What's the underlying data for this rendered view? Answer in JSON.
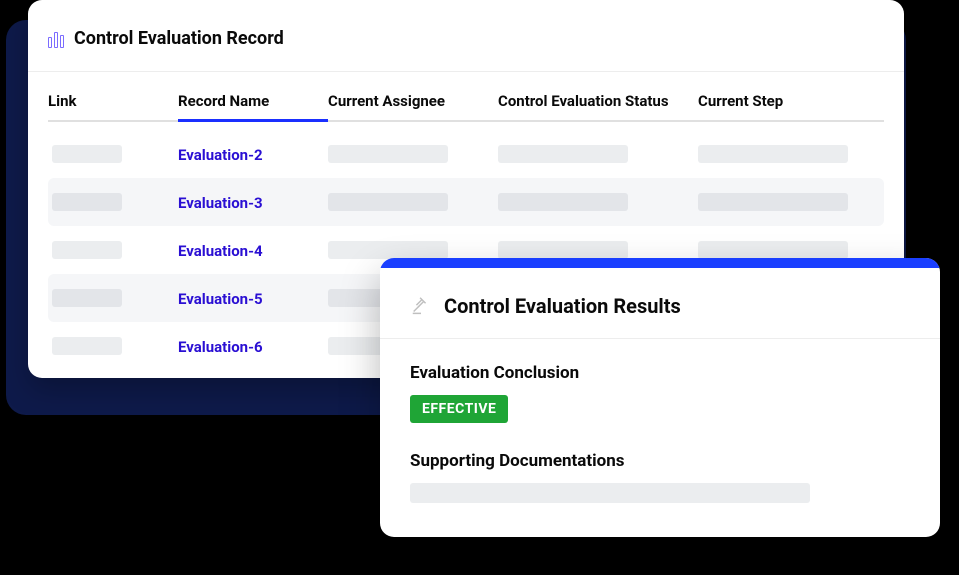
{
  "panel": {
    "title": "Control Evaluation Record"
  },
  "columns": {
    "link": "Link",
    "record_name": "Record Name",
    "assignee": "Current Assignee",
    "status": "Control Evaluation Status",
    "step": "Current Step"
  },
  "rows": [
    {
      "name": "Evaluation-2",
      "alt": false
    },
    {
      "name": "Evaluation-3",
      "alt": true
    },
    {
      "name": "Evaluation-4",
      "alt": false
    },
    {
      "name": "Evaluation-5",
      "alt": true
    },
    {
      "name": "Evaluation-6",
      "alt": false
    }
  ],
  "results": {
    "title": "Control Evaluation Results",
    "conclusion_label": "Evaluation Conclusion",
    "conclusion_value": "EFFECTIVE",
    "supporting_label": "Supporting Documentations"
  }
}
